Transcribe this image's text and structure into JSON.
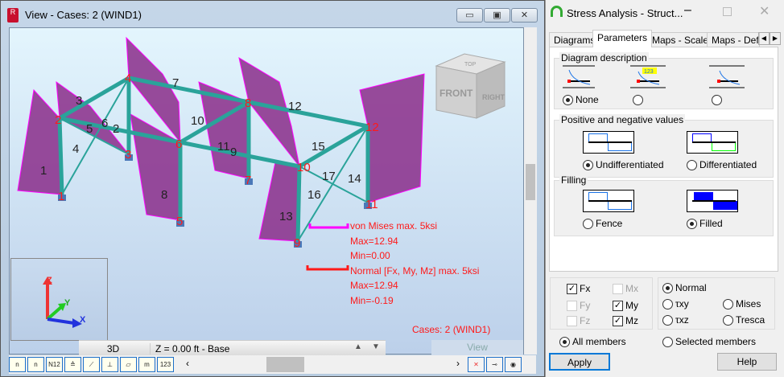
{
  "view_window": {
    "title": "View - Cases: 2 (WIND1)",
    "min": "▭",
    "max": "▣",
    "close": "✕"
  },
  "model": {
    "nodes": [
      {
        "id": "1"
      },
      {
        "id": "2"
      },
      {
        "id": "3"
      },
      {
        "id": "4"
      },
      {
        "id": "5"
      },
      {
        "id": "6"
      },
      {
        "id": "7"
      },
      {
        "id": "8"
      },
      {
        "id": "9"
      },
      {
        "id": "10"
      },
      {
        "id": "11"
      },
      {
        "id": "12"
      }
    ],
    "members": [
      "1",
      "2",
      "3",
      "4",
      "5",
      "6",
      "7",
      "8",
      "9",
      "10",
      "11",
      "12",
      "13",
      "14",
      "15",
      "16",
      "17"
    ]
  },
  "viewcube": {
    "front": "FRONT",
    "right": "RIGHT",
    "top": "TOP"
  },
  "axes": {
    "z": "Z",
    "y": "Y",
    "x": "X"
  },
  "legend": {
    "mises_title": "von Mises max. 5ksi",
    "mises_max": "Max=12.94",
    "mises_min": "Min=0.00",
    "normal_title": "Normal [Fx, My, Mz] max. 5ksi",
    "normal_max": "Max=12.94",
    "normal_min": "Min=-0.19",
    "cases": "Cases: 2 (WIND1)"
  },
  "status": {
    "mode": "3D",
    "level": "Z = 0.00 ft - Base",
    "view": "View"
  },
  "toolbar": [
    "n",
    "n",
    "N12",
    "≙",
    "⟋",
    "⊥",
    "▱",
    "m",
    "123"
  ],
  "dialog": {
    "title": "Stress Analysis - Struct...",
    "tabs": [
      "Diagrams",
      "Parameters",
      "Maps - Scale",
      "Maps - Def"
    ],
    "active_tab": "Parameters",
    "diagram_description": {
      "label": "Diagram description",
      "none": "None",
      "badge": "123"
    },
    "pos_neg": {
      "label": "Positive and negative values",
      "undiff": "Undifferentiated",
      "diff": "Differentiated"
    },
    "filling": {
      "label": "Filling",
      "fence": "Fence",
      "filled": "Filled"
    },
    "forces": {
      "fx": "Fx",
      "fy": "Fy",
      "fz": "Fz",
      "mx": "Mx",
      "my": "My",
      "mz": "Mz"
    },
    "stress": {
      "normal": "Normal",
      "txy": "τxy",
      "txz": "τxz",
      "mises": "Mises",
      "tresca": "Tresca"
    },
    "members": {
      "all": "All members",
      "selected": "Selected members"
    },
    "apply": "Apply",
    "help": "Help"
  },
  "colors": {
    "diagram": "#8a2d8a",
    "frame": "#2aa39a",
    "node": "#ff1a1a",
    "accent": "#0078d7"
  }
}
